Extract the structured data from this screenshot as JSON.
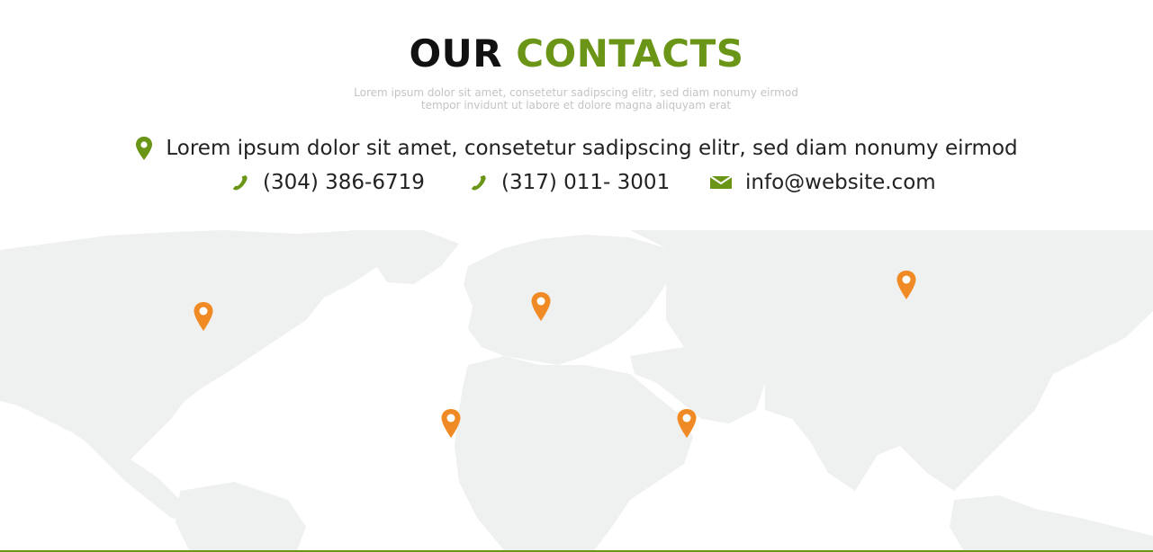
{
  "header": {
    "title_part1": "OUR",
    "title_part2": "CONTACTS",
    "subtitle_line1": "Lorem ipsum dolor sit amet, consetetur sadipscing elitr, sed diam nonumy eirmod",
    "subtitle_line2": "tempor invidunt ut labore et dolore magna aliquyam erat"
  },
  "contact": {
    "address": "Lorem ipsum dolor sit amet, consetetur sadipscing elitr, sed diam nonumy eirmod",
    "phone1": "(304) 386-6719",
    "phone2": "(317) 011- 3001",
    "email": "info@website.com"
  },
  "map": {
    "markers": [
      "north-america-marker",
      "europe-marker",
      "asia-marker",
      "west-africa-marker",
      "middle-east-marker"
    ]
  },
  "colors": {
    "accent_green": "#6a9516",
    "marker_orange": "#f08a24",
    "map_land": "#eff0f0",
    "text_dark": "#222222"
  },
  "icons": {
    "address": "location-pin-icon",
    "phone": "phone-icon",
    "email": "envelope-icon"
  }
}
